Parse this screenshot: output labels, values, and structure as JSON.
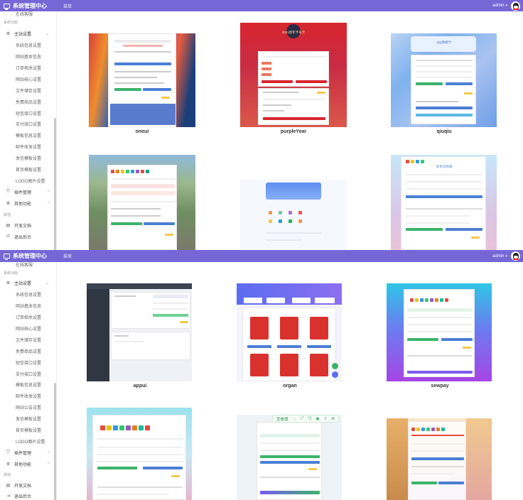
{
  "app": {
    "title": "系统管理中心",
    "menu_toggle": "菜单",
    "user": "admin",
    "user_caret": "▾"
  },
  "sidebar_top": {
    "partial_item": "在线客服",
    "section_system": "系统功能",
    "group_main": "主站设置",
    "items": [
      "系统信息设置",
      "网站基本信息",
      "订单相关设置",
      "网站核心设置",
      "文件储存设置",
      "免费商品设置",
      "短信接口设置",
      "支付接口设置",
      "模板信息设置",
      "邮件收发设置",
      "发信模板设置",
      "首页模板设置",
      "LOGO图片设置"
    ],
    "group_plugins": "插件管理",
    "group_others": "其他功能",
    "section_others": "其他",
    "dev_docs": "开发文档",
    "logout": "退出后台"
  },
  "sidebar_bottom": {
    "partial_item": "在线客服",
    "section_system": "系统功能",
    "group_main": "主站设置",
    "items": [
      "系统信息设置",
      "网站基本信息",
      "订单相关设置",
      "网站核心设置",
      "文件储存设置",
      "免费商品设置",
      "短信接口设置",
      "支付接口设置",
      "模板信息设置",
      "邮件收发设置",
      "网站公告设置",
      "发信模板设置",
      "首页模板设置",
      "LOGO图片设置"
    ],
    "group_plugins": "插件管理",
    "group_others": "其他功能",
    "section_others": "其他",
    "dev_docs": "开发文档",
    "logout": "退出后台"
  },
  "templates_top": [
    "oneui",
    "purpleYear",
    "qiuqiu",
    "",
    "",
    ""
  ],
  "templates_bottom": [
    "appui",
    "organ",
    "sewpay",
    "",
    "",
    ""
  ],
  "top_thumb_texts": {
    "purple_title": "2021新年卡号卡",
    "qiuqiu_title": "QQ系统卡",
    "shop_title": "优享云商城"
  },
  "float_toolbar": {
    "label": "查看器",
    "icons": [
      "fit-icon",
      "fullscreen-icon",
      "copy-icon",
      "save-icon",
      "download-icon",
      "settings-icon"
    ]
  },
  "colors": {
    "header": "#7767d6",
    "accent_blue": "#4a7fd4",
    "accent_green": "#3bb36b"
  }
}
